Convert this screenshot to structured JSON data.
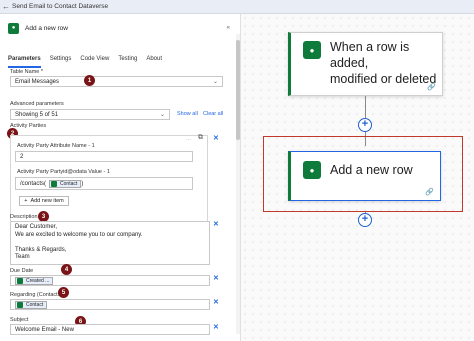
{
  "window": {
    "title": "Send Email to Contact Dataverse"
  },
  "panel": {
    "action_name": "Add a new row",
    "tabs": [
      "Parameters",
      "Settings",
      "Code View",
      "Testing",
      "About"
    ],
    "table_name": {
      "label": "Table Name *",
      "value": "Email Messages"
    },
    "advanced": {
      "label": "Advanced parameters",
      "value": "Showing 5 of 51",
      "show_all": "Show all",
      "clear_all": "Clear all"
    },
    "activity_parties": {
      "label": "Activity Parties",
      "attr_label": "Activity Party Attribute Name - 1",
      "attr_value": "2",
      "party_label": "Activity Party Partyid@odata Value - 1",
      "party_prefix": "/contacts(",
      "party_token": "Contact",
      "party_suffix": ")",
      "add_item": "Add new item"
    },
    "description": {
      "label": "Description",
      "lines": [
        "Dear Customer,",
        "We are excited to welcome you to our company.",
        "",
        "Thanks & Regards,",
        "Team"
      ]
    },
    "due_date": {
      "label": "Due Date",
      "token": "Created ..."
    },
    "regarding": {
      "label": "Regarding (Contacts)",
      "token": "Contact"
    },
    "subject": {
      "label": "Subject",
      "value": "Welcome Email - New"
    },
    "badges": [
      "1",
      "2",
      "3",
      "4",
      "5",
      "6"
    ]
  },
  "flow": {
    "trigger_title": "When a row is added, modified or deleted",
    "trigger_title_lines": [
      "When a row is added,",
      "modified or deleted"
    ],
    "action_title": "Add a new row"
  },
  "colors": {
    "accent": "#2266e3",
    "dataverse": "#0f7b3a",
    "badge": "#7a1416",
    "highlight": "#c0392b"
  }
}
